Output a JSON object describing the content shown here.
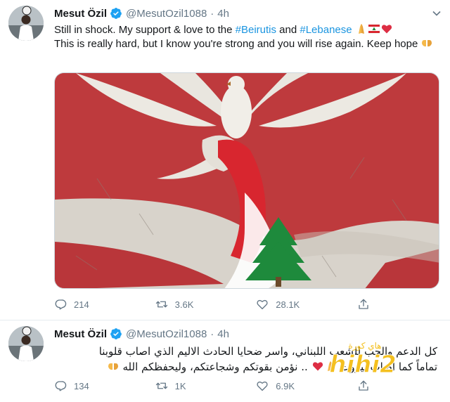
{
  "tweets": [
    {
      "author": {
        "name": "Mesut Özil",
        "handle": "@MesutOzil1088",
        "time": "4h"
      },
      "text": {
        "part1": "Still in shock. My support & love to the ",
        "hashtag1": "#Beirutis",
        "part2": " and ",
        "hashtag2": "#Lebanese",
        "part3": "This is really hard, but I know you're strong and you will rise again. Keep hope"
      },
      "stats": {
        "replies": "214",
        "retweets": "3.6K",
        "likes": "28.1K"
      }
    },
    {
      "author": {
        "name": "Mesut Özil",
        "handle": "@MesutOzil1088",
        "time": "4h"
      },
      "text": {
        "line1": "كل الدعم والحب للشعب اللبناني، واسر ضحايا الحادث الاليم الذي اصاب قلوبنا",
        "line2": "تماماً كما اصاب بيروت",
        "line2b": ".. نؤمن بقوتكم وشجاعتكم، وليحفظكم الله"
      },
      "stats": {
        "replies": "134",
        "retweets": "1K",
        "likes": "6.9K"
      }
    }
  ],
  "watermark": {
    "text": "hihi2",
    "subtext": "هاي كورة"
  },
  "colors": {
    "brand": "#1da1f2",
    "hashtag": "#1b95e0",
    "muted": "#657786",
    "flag_red": "#d8262f",
    "cedar": "#1e8a3c"
  },
  "icons": [
    "verified-icon",
    "caret-down-icon",
    "reply-icon",
    "retweet-icon",
    "like-icon",
    "share-icon"
  ]
}
